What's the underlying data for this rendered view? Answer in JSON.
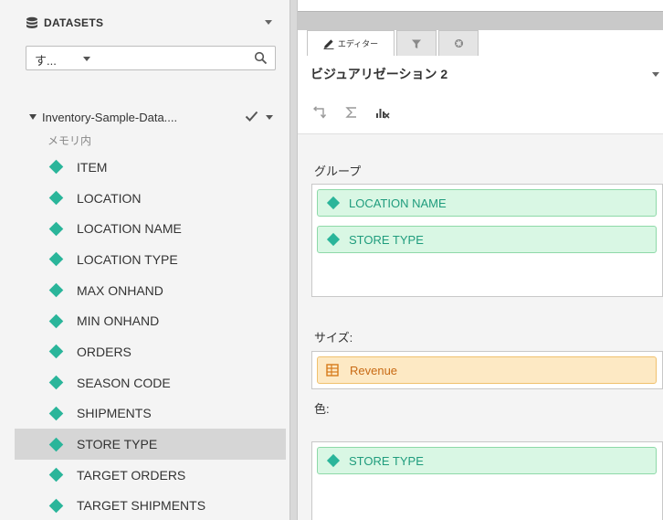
{
  "colors": {
    "category_field": "#2ab59a",
    "category_pill_bg": "#d9f7e4",
    "measure_pill_bg": "#fde9c4",
    "measure_text": "#c86a14",
    "selected_row": "#d6d6d6"
  },
  "datasets_panel": {
    "title": "DATASETS",
    "icon": "database-icon",
    "search": {
      "value": "す...",
      "icon": "search-icon"
    },
    "dataset": {
      "name": "Inventory-Sample-Data....",
      "status": "メモリ内",
      "icons": [
        "expand-triangle-icon",
        "checkmark-icon",
        "chevron-down-icon"
      ]
    },
    "fields": [
      {
        "label": "ITEM",
        "selected": false
      },
      {
        "label": "LOCATION",
        "selected": false
      },
      {
        "label": "LOCATION NAME",
        "selected": false
      },
      {
        "label": "LOCATION TYPE",
        "selected": false
      },
      {
        "label": "MAX ONHAND",
        "selected": false
      },
      {
        "label": "MIN ONHAND",
        "selected": false
      },
      {
        "label": "ORDERS",
        "selected": false
      },
      {
        "label": "SEASON CODE",
        "selected": false
      },
      {
        "label": "SHIPMENTS",
        "selected": false
      },
      {
        "label": "STORE TYPE",
        "selected": true
      },
      {
        "label": "TARGET ORDERS",
        "selected": false
      },
      {
        "label": "TARGET SHIPMENTS",
        "selected": false
      }
    ]
  },
  "editor_panel": {
    "tabs": [
      {
        "label": "エディター",
        "icon": "pencil-icon",
        "active": true
      },
      {
        "label": "",
        "icon": "filter-icon",
        "active": false
      },
      {
        "label": "",
        "icon": "gear-icon",
        "active": false
      }
    ],
    "visualization_title": "ビジュアリゼーション 2",
    "toolbar_icons": [
      "pivot-icon",
      "sigma-icon",
      "clear-chart-icon"
    ],
    "group": {
      "label": "グループ",
      "pills": [
        "LOCATION NAME",
        "STORE TYPE"
      ]
    },
    "size": {
      "label": "サイズ:",
      "pills": [
        "Revenue"
      ]
    },
    "color": {
      "label": "色:",
      "pills": [
        "STORE TYPE"
      ]
    }
  }
}
